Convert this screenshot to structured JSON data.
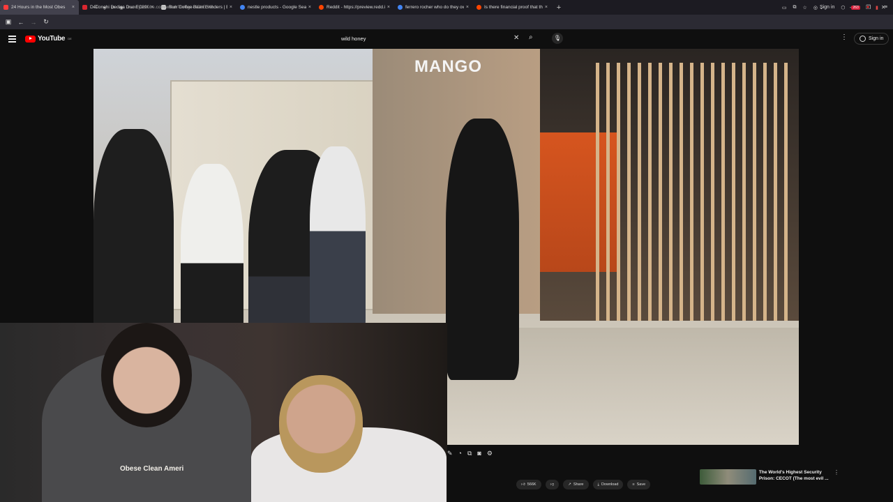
{
  "browser": {
    "tabs": [
      {
        "label": "24 Hours in the Most Obes",
        "color": "#ff3b3b",
        "active": true
      },
      {
        "label": "DeLonghi Dedica Duo EC890.GI",
        "color": "#d9262f",
        "active": false
      },
      {
        "label": "Burr Coffee Bean Grinders | Bre",
        "color": "#cccccc",
        "active": false
      },
      {
        "label": "nestle products - Google Search",
        "color": "#4285f4",
        "active": false
      },
      {
        "label": "Reddit - https://preview.redd.it",
        "color": "#ff4500",
        "active": false
      },
      {
        "label": "ferrero rocher who do they own",
        "color": "#4285f4",
        "active": false
      },
      {
        "label": "Is there financial proof that the",
        "color": "#ff4500",
        "active": false
      }
    ],
    "tab_close_glyph": "×",
    "new_tab_glyph": "+",
    "url": "www.youtube.com/watch?v=cgu-XOhE5k8",
    "signin_label": "Sign in",
    "ext_badge": "263"
  },
  "youtube": {
    "logo_text": "YouTube",
    "country_code": "DE",
    "search_value": "wild honey",
    "signin_label": "Sign in"
  },
  "video": {
    "store_sign": "MANGO",
    "shirt_text": "Obese Clean Ameri"
  },
  "recommendation": {
    "title": "The World's Highest Security Prison: CECOT (The most evil ..."
  },
  "actions": [
    {
      "label": "566K",
      "icon": "like-icon"
    },
    {
      "label": "",
      "icon": "dislike-icon"
    },
    {
      "label": "Share",
      "icon": "share-icon"
    },
    {
      "label": "Download",
      "icon": "download-icon"
    },
    {
      "label": "Save",
      "icon": "save-icon"
    }
  ],
  "colors": {
    "yt_red": "#ff0000",
    "browser_bg": "#1c1b22",
    "page_bg": "#0f0f0f"
  }
}
